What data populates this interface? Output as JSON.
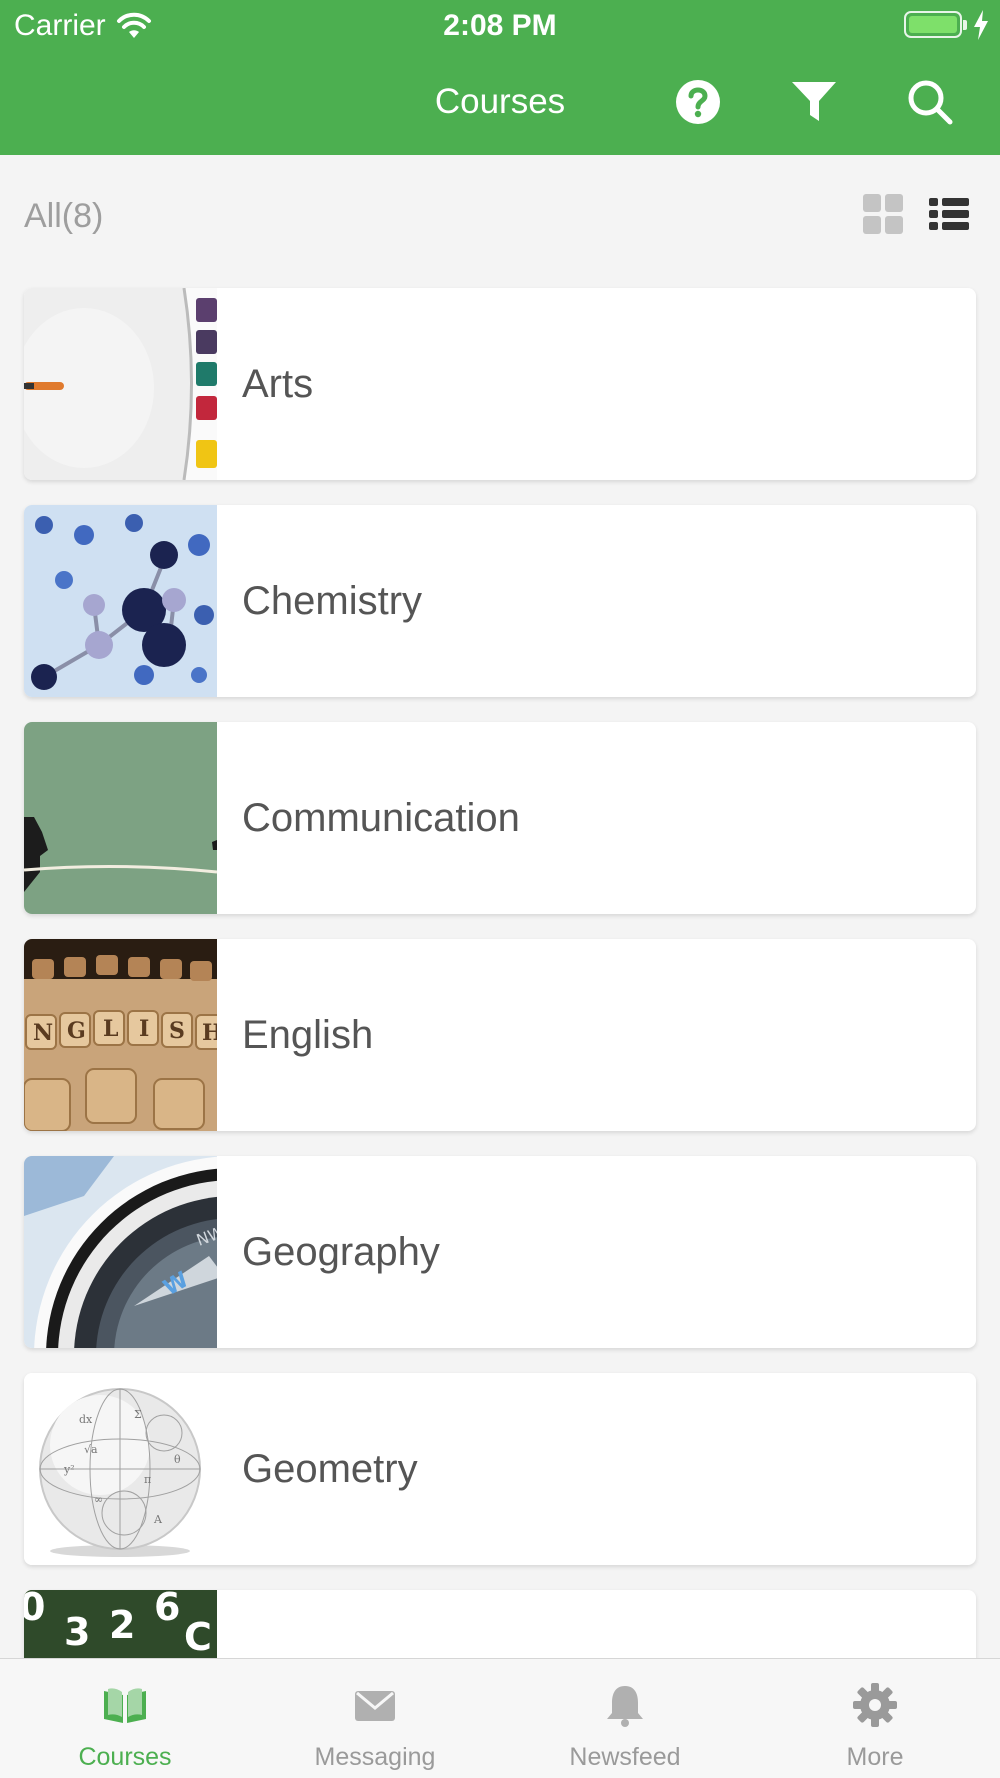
{
  "status_bar": {
    "carrier": "Carrier",
    "time": "2:08 PM"
  },
  "nav": {
    "title": "Courses",
    "icons": [
      "help-icon",
      "filter-icon",
      "search-icon"
    ]
  },
  "filter": {
    "count_label": "All(8)",
    "view_modes": [
      "grid-view-icon",
      "list-view-icon"
    ],
    "active_view": "list"
  },
  "courses": [
    {
      "name": "Arts",
      "thumb": "paint-palette-image"
    },
    {
      "name": "Chemistry",
      "thumb": "molecule-image"
    },
    {
      "name": "Communication",
      "thumb": "tin-can-phone-image"
    },
    {
      "name": "English",
      "thumb": "letter-cubes-image"
    },
    {
      "name": "Geography",
      "thumb": "compass-image"
    },
    {
      "name": "Geometry",
      "thumb": "formula-sphere-image"
    },
    {
      "name": "",
      "thumb": "numbers-image"
    }
  ],
  "tabs": [
    {
      "label": "Courses",
      "icon": "book-icon",
      "active": true
    },
    {
      "label": "Messaging",
      "icon": "envelope-icon",
      "active": false
    },
    {
      "label": "Newsfeed",
      "icon": "bell-icon",
      "active": false
    },
    {
      "label": "More",
      "icon": "gear-icon",
      "active": false
    }
  ],
  "colors": {
    "primary": "#4caf50",
    "background": "#f4f4f4",
    "tab_inactive": "#9a9a9a",
    "text": "#555555"
  }
}
